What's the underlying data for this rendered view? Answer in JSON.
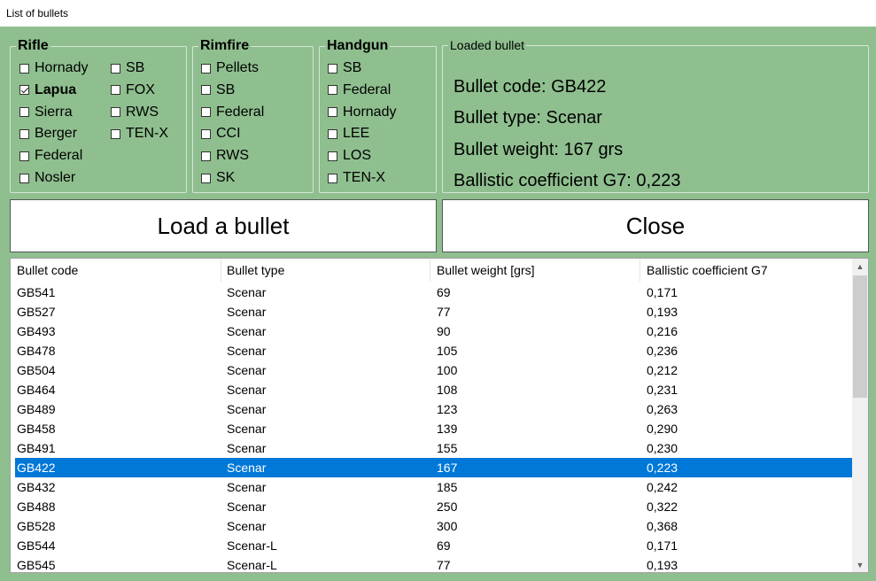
{
  "window": {
    "title": "List of bullets"
  },
  "rifle": {
    "legend": "Rifle",
    "items": [
      {
        "label": "Hornady",
        "checked": false
      },
      {
        "label": "Lapua",
        "checked": true
      },
      {
        "label": "Sierra",
        "checked": false
      },
      {
        "label": "Berger",
        "checked": false
      },
      {
        "label": "Federal",
        "checked": false
      },
      {
        "label": "Nosler",
        "checked": false
      },
      {
        "label": "SB",
        "checked": false
      },
      {
        "label": "FOX",
        "checked": false
      },
      {
        "label": "RWS",
        "checked": false
      },
      {
        "label": "TEN-X",
        "checked": false
      }
    ]
  },
  "rimfire": {
    "legend": "Rimfire",
    "items": [
      {
        "label": "Pellets",
        "checked": false
      },
      {
        "label": "SB",
        "checked": false
      },
      {
        "label": "Federal",
        "checked": false
      },
      {
        "label": "CCI",
        "checked": false
      },
      {
        "label": "RWS",
        "checked": false
      },
      {
        "label": "SK",
        "checked": false
      }
    ]
  },
  "handgun": {
    "legend": "Handgun",
    "items": [
      {
        "label": "SB",
        "checked": false
      },
      {
        "label": "Federal",
        "checked": false
      },
      {
        "label": "Hornady",
        "checked": false
      },
      {
        "label": "LEE",
        "checked": false
      },
      {
        "label": "LOS",
        "checked": false
      },
      {
        "label": "TEN-X",
        "checked": false
      }
    ]
  },
  "loaded": {
    "legend": "Loaded bullet",
    "code": "Bullet code: GB422",
    "type": "Bullet type: Scenar",
    "weight": "Bullet weight: 167 grs",
    "bc": "Ballistic coefficient G7: 0,223"
  },
  "buttons": {
    "load": "Load a bullet",
    "close": "Close"
  },
  "list": {
    "columns": [
      "Bullet code",
      "Bullet type",
      "Bullet weight [grs]",
      "Ballistic coefficient G7"
    ],
    "selected_index": 9,
    "rows": [
      [
        "GB541",
        "Scenar",
        "69",
        "0,171"
      ],
      [
        "GB527",
        "Scenar",
        "77",
        "0,193"
      ],
      [
        "GB493",
        "Scenar",
        "90",
        "0,216"
      ],
      [
        "GB478",
        "Scenar",
        "105",
        "0,236"
      ],
      [
        "GB504",
        "Scenar",
        "100",
        "0,212"
      ],
      [
        "GB464",
        "Scenar",
        "108",
        "0,231"
      ],
      [
        "GB489",
        "Scenar",
        "123",
        "0,263"
      ],
      [
        "GB458",
        "Scenar",
        "139",
        "0,290"
      ],
      [
        "GB491",
        "Scenar",
        "155",
        "0,230"
      ],
      [
        "GB422",
        "Scenar",
        "167",
        "0,223"
      ],
      [
        "GB432",
        "Scenar",
        "185",
        "0,242"
      ],
      [
        "GB488",
        "Scenar",
        "250",
        "0,322"
      ],
      [
        "GB528",
        "Scenar",
        "300",
        "0,368"
      ],
      [
        "GB544",
        "Scenar-L",
        "69",
        "0,171"
      ],
      [
        "GB545",
        "Scenar-L",
        "77",
        "0,193"
      ]
    ]
  },
  "icons": {
    "scroll_up": "scroll-up-arrow-icon",
    "scroll_down": "scroll-down-arrow-icon"
  }
}
